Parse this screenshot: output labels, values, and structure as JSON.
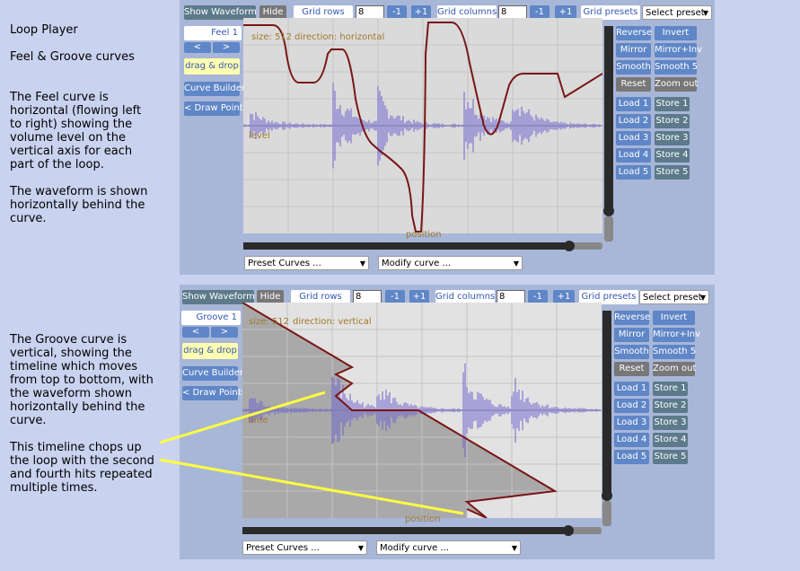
{
  "sidebar": {
    "title": "Loop Player",
    "subtitle": "Feel & Groove curves",
    "feel_desc": "The Feel curve is horizontal (flowing left to right) showing the volume level on the vertical axis for each part of the loop.",
    "waveform_desc": "The waveform is shown horizontally behind the curve.",
    "groove_desc": "The Groove curve is vertical, showing the timeline which moves from top to bottom, with the waveform shown horizontally behind the curve.",
    "chop_desc": "This timeline chops up the loop with the second and fourth hits repeated multiple times."
  },
  "toolbar": {
    "show_waveform": "Show Waveform",
    "hide": "Hide",
    "grid_rows_label": "Grid rows",
    "grid_rows_value": "8",
    "minus": "-1",
    "plus": "+1",
    "grid_columns_label": "Grid columns",
    "grid_columns_value": "8",
    "grid_presets_label": "Grid presets",
    "select_preset": "Select preset"
  },
  "left_controls": {
    "drag_drop": "drag & drop",
    "curve_builder": "Curve Builder",
    "draw_points": "< Draw Points",
    "prev": "<",
    "next": ">"
  },
  "right_controls": {
    "reverse": "Reverse",
    "invert": "Invert",
    "mirror": "Mirror",
    "mirror_inv": "Mirror+Inv",
    "smooth": "Smooth",
    "smooth5": "Smooth 5",
    "reset": "Reset",
    "zoom_out": "Zoom out",
    "loads": [
      "Load 1",
      "Load 2",
      "Load 3",
      "Load 4",
      "Load 5"
    ],
    "stores": [
      "Store 1",
      "Store 2",
      "Store 3",
      "Store 4",
      "Store 5"
    ]
  },
  "bottom": {
    "preset_curves": "Preset Curves ...",
    "modify_curve": "Modify curve ..."
  },
  "feel_panel": {
    "curve_name": "Feel 1",
    "size_label": "size: 512",
    "direction_label": "direction: horizontal",
    "axis_level": "level",
    "axis_position": "position"
  },
  "groove_panel": {
    "curve_name": "Groove 1",
    "size_label": "size: 512",
    "direction_label": "direction: vertical",
    "axis_level": "time",
    "axis_position": "position"
  },
  "colors": {
    "background": "#c9d2ef",
    "panel": "#a8b6d8",
    "plot_bg": "#e2e2e2",
    "curve": "#7a1515",
    "waveform": "#6d62cf",
    "annotation": "#ffff40"
  }
}
